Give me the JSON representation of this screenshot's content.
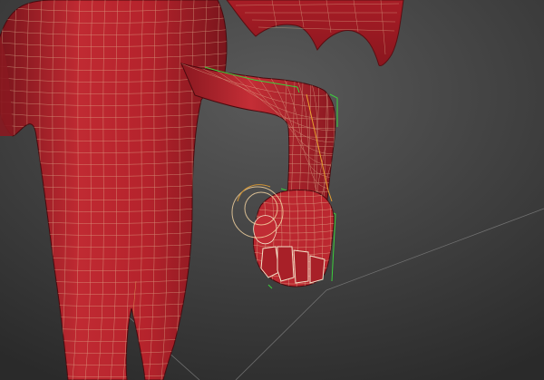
{
  "viewport": {
    "background_top": "#575757",
    "background_bottom": "#2c2c2c"
  },
  "model": {
    "body_color": "#b5232c",
    "body_shadow": "#6e1218",
    "body_highlight": "#d23a40",
    "wing_color": "#9c1a22",
    "wireframe_color": "#e8c8a0",
    "wireframe_alt_color": "#f0e070"
  },
  "gizmos": {
    "bounding_box_color": "#3ccf3c",
    "bone_color": "#e8a030",
    "rotate_gizmo_color": "#f2d2a0",
    "ground_line_color": "#8a8a8a"
  }
}
